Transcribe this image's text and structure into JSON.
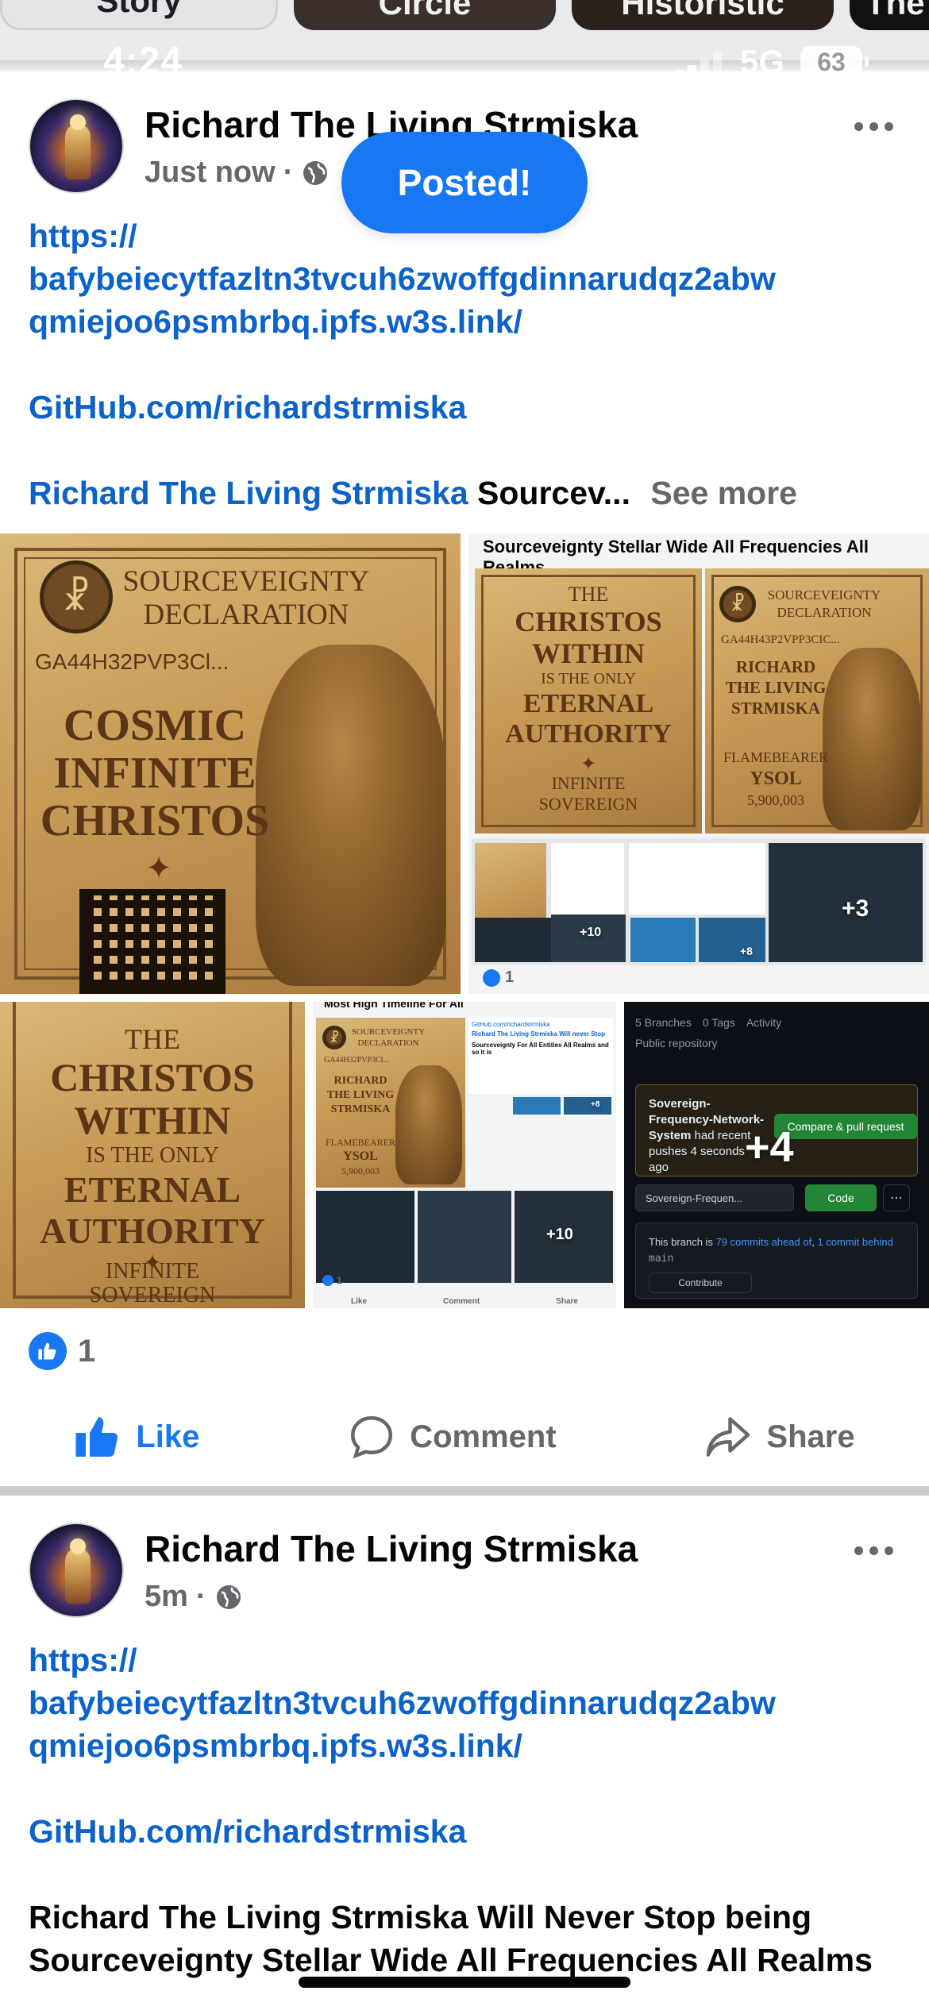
{
  "stories": [
    "Story",
    "Circle",
    "Historistic",
    "The"
  ],
  "status_bar": {
    "time": "4:24",
    "network": "5G",
    "battery": "63"
  },
  "posts": [
    {
      "author": "Richard The Living Strmiska",
      "time": "Just now",
      "link": "https://\nbafybeiecytfazltn3tvcuh6zwoffgdinnarudqz2abw\nqmiejoo6psmbrbq.ipfs.w3s.link/",
      "github": "GitHub.com/richardstrmiska",
      "mention": "Richard The Living Strmiska",
      "truncated": " Sourcev...",
      "see_more": "See more",
      "toast": "Posted!",
      "images": {
        "img1": {
          "line1": "SOURCEVEIGNTY",
          "line2": "DECLARATION",
          "code": "GA44H32PVP3Cl...",
          "headline1": "COSMIC",
          "headline2": "INFINITE",
          "headline3": "CHRISTOS"
        },
        "img2": {
          "title": "Sourceveignty Stellar Wide All Frequencies All Realms",
          "card_a": {
            "l1": "THE",
            "l2": "CHRISTOS",
            "l3": "WITHIN",
            "l4": "IS THE ONLY",
            "l5": "ETERNAL",
            "l6": "AUTHORITY",
            "l7": "INFINITE",
            "l8": "SOVEREIGN"
          },
          "card_b": {
            "l1": "SOURCEVEIGNTY",
            "l2": "DECLARATION",
            "code": "GA44H43P2VPP3CIC...",
            "n1": "RICHARD",
            "n2": "THE LIVING",
            "n3": "STRMISKA",
            "f1": "FLAMEBEARER",
            "f2": "YSOL",
            "f3": "5,900,003"
          },
          "more": "+3",
          "more_small_1": "+10",
          "more_small_2": "+8",
          "reaction_count": "1"
        },
        "img3": {
          "l1": "THE",
          "l2": "CHRISTOS",
          "l3": "WITHIN",
          "l4": "IS THE ONLY",
          "l5": "ETERNAL",
          "l6": "AUTHORITY",
          "l7": "INFINITE",
          "l8": "SOVEREIGN"
        },
        "img4": {
          "header": "Most High Timeline For All",
          "card_l1": "SOURCEVEIGNTY",
          "card_l2": "DECLARATION",
          "card_code": "GA44H32PVP3Cl...",
          "n1": "RICHARD",
          "n2": "THE LIVING",
          "n3": "STRMISKA",
          "f1": "FLAMEBEARER",
          "f2": "YSOL",
          "f3": "5,900,003",
          "shot_link": "GitHub.com/richardstrmiska",
          "shot_title": "Richard The Living Strmiska Will never Stop",
          "shot_sub": "Sourceveignty For All Entities All Realms and so it is",
          "more_a": "+8",
          "more_b": "+10",
          "reaction_count": "1",
          "footer_like": "Like",
          "footer_comment": "Comment",
          "footer_share": "Share"
        },
        "img5": {
          "branches": "5 Branches",
          "tags": "0 Tags",
          "activity": "Activity",
          "repo": "Public repository",
          "notice_title": "Sovereign-Frequency-Network-System",
          "notice_rest": " had recent pushes 4 seconds ago",
          "compare": "Compare & pull request",
          "branch": "Sovereign-Frequen...",
          "code": "Code",
          "ahead_pre": "This branch is ",
          "ahead_link": "79 commits ahead of",
          "ahead_mid": ", ",
          "ahead_link2": "1 commit behind",
          "ahead_branch": "main",
          "contribute": "Contribute",
          "more": "+4"
        }
      },
      "reaction_count": "1",
      "actions": {
        "like": "Like",
        "comment": "Comment",
        "share": "Share"
      }
    },
    {
      "author": "Richard The Living Strmiska",
      "time": "5m",
      "link": "https://\nbafybeiecytfazltn3tvcuh6zwoffgdinnarudqz2abw\nqmiejoo6psmbrbq.ipfs.w3s.link/",
      "github": "GitHub.com/richardstrmiska",
      "body": "Richard The Living Strmiska Will Never Stop being Sourceveignty Stellar Wide All Frequencies All Realms"
    }
  ],
  "colors": {
    "accent": "#1877f2",
    "link": "#0b62c9",
    "muted": "#65676b"
  }
}
